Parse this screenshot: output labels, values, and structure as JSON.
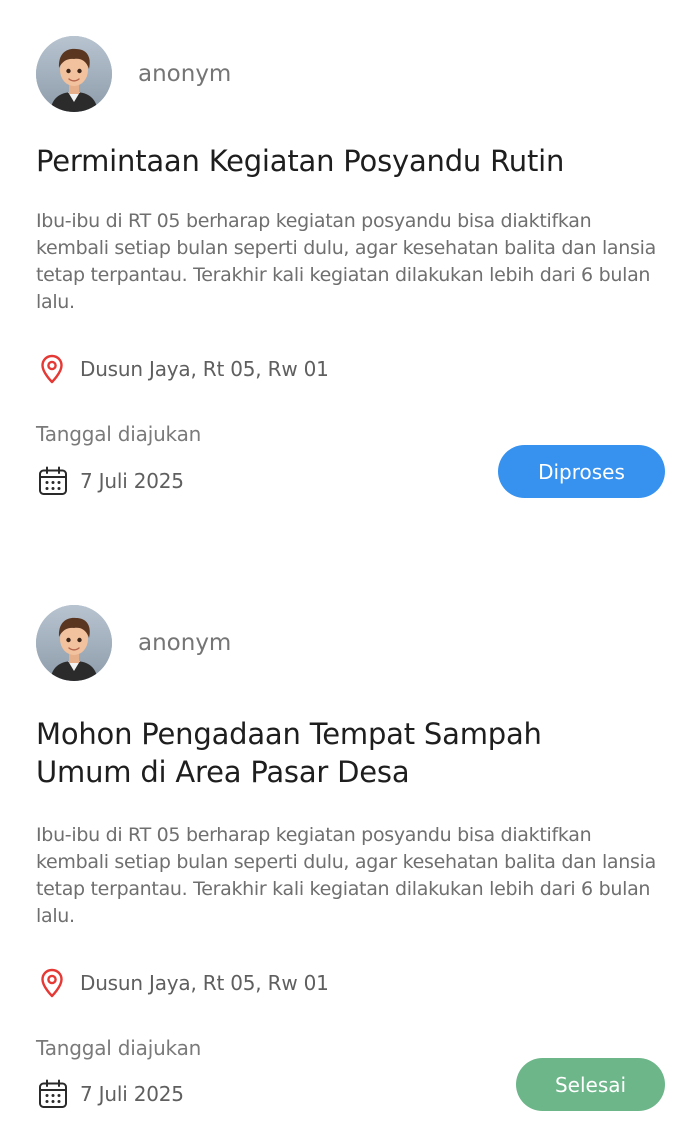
{
  "reports": [
    {
      "author": "anonym",
      "title": "Permintaan Kegiatan Posyandu Rutin",
      "description": "Ibu-ibu di RT 05 berharap kegiatan posyandu bisa diaktifkan kembali setiap bulan seperti dulu, agar kesehatan balita dan lansia tetap terpantau. Terakhir kali kegiatan dilakukan lebih dari 6 bulan lalu.",
      "location": "Dusun Jaya, Rt 05, Rw 01",
      "date_label": "Tanggal diajukan",
      "date": "7 Juli 2025",
      "status": "Diproses",
      "status_color": "#3792ef"
    },
    {
      "author": "anonym",
      "title": "Mohon Pengadaan Tempat Sampah Umum di Area Pasar Desa",
      "description": "Ibu-ibu di RT 05 berharap kegiatan posyandu bisa diaktifkan kembali setiap bulan seperti dulu, agar kesehatan balita dan lansia tetap terpantau. Terakhir kali kegiatan dilakukan lebih dari 6 bulan lalu.",
      "location": "Dusun Jaya, Rt 05, Rw 01",
      "date_label": "Tanggal diajukan",
      "date": "7 Juli 2025",
      "status": "Selesai",
      "status_color": "#6db68a"
    }
  ],
  "icons": {
    "avatar": "avatar",
    "location": "map-pin-icon",
    "date": "calendar-icon"
  },
  "colors": {
    "pin": "#e53935",
    "text_muted": "#6f6f6f"
  }
}
